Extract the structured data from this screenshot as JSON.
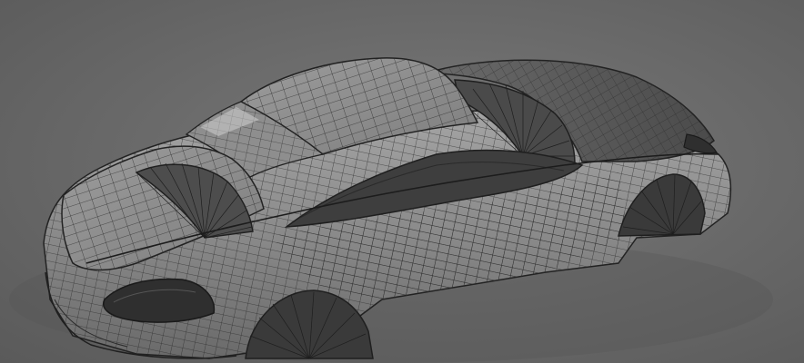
{
  "scene": {
    "subject": "car-body-wireframe-model",
    "colors": {
      "background": "#6c6c6c",
      "surface_light": "#9a9a9a",
      "surface_mid": "#7d7d7d",
      "surface_dark": "#4a4a4a",
      "wire": "#2a2a2a",
      "glass": "#3d3d3d"
    }
  }
}
